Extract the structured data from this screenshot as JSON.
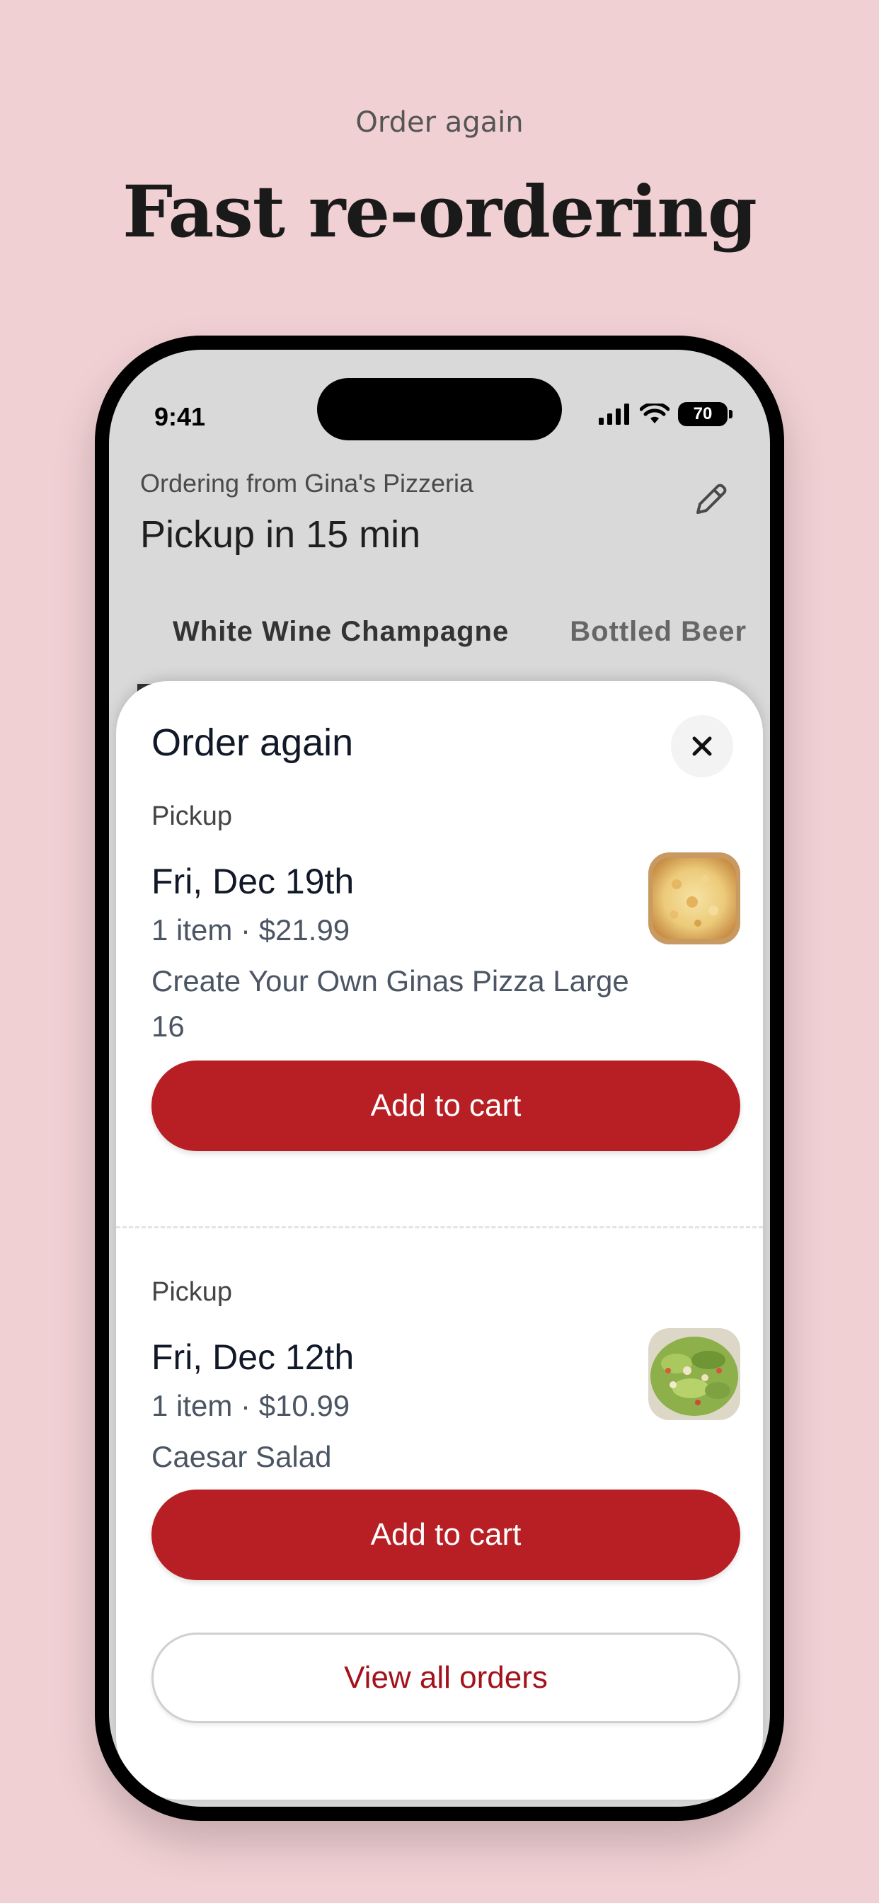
{
  "promo": {
    "eyebrow": "Order again",
    "headline": "Fast re-ordering"
  },
  "status_bar": {
    "time": "9:41",
    "battery": "70",
    "icons": [
      "signal-icon",
      "wifi-icon",
      "battery-icon"
    ]
  },
  "header": {
    "ordering_from": "Ordering from Gina's Pizzeria",
    "pickup_time": "Pickup in 15 min",
    "edit_icon": "pencil-icon"
  },
  "tabs": [
    {
      "label": "White Wine Champagne"
    },
    {
      "label": "Bottled Beer"
    }
  ],
  "sheet": {
    "title": "Order again",
    "close_icon": "close-icon",
    "orders": [
      {
        "type": "Pickup",
        "date": "Fri, Dec 19th",
        "meta": "1 item · $21.99",
        "items": "Create Your Own Ginas Pizza Large 16",
        "image": "pizza-image",
        "button": "Add to cart"
      },
      {
        "type": "Pickup",
        "date": "Fri, Dec 12th",
        "meta": "1 item · $10.99",
        "items": "Caesar Salad",
        "image": "salad-image",
        "button": "Add to cart"
      }
    ],
    "view_all": "View all orders"
  },
  "colors": {
    "background": "#f0d0d3",
    "accent": "#b71f25",
    "link": "#a3121a"
  }
}
